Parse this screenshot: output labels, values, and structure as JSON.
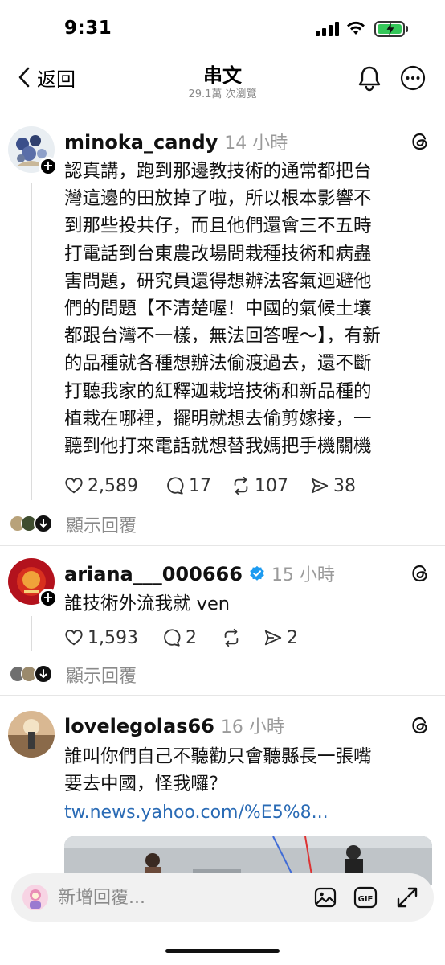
{
  "status": {
    "time": "9:31"
  },
  "header": {
    "back_label": "返回",
    "title": "串文",
    "subtitle": "29.1萬 次瀏覽"
  },
  "posts": [
    {
      "username": "minoka_candy",
      "time": "14 小時",
      "lines": [
        "認真講，跑到那邊教技術的通常都把台",
        "灣這邊的田放掉了啦，所以根本影響不",
        "到那些投共仔，而且他們還會三不五時",
        "打電話到台東農改場問栽種技術和病蟲",
        "害問題，研究員還得想辦法客氣迴避他",
        "們的問題【不清楚喔！中國的氣候土壤",
        "都跟台灣不一樣，無法回答喔～】，有新",
        "的品種就各種想辦法偷渡過去，還不斷",
        "打聽我家的紅釋迦栽培技術和新品種的",
        "植栽在哪裡，擺明就想去偷剪嫁接，一",
        "聽到他打來電話就想替我媽把手機關機"
      ],
      "likes": "2,589",
      "comments": "17",
      "reposts": "107",
      "shares": "38",
      "replies_label": "顯示回覆"
    },
    {
      "username": "ariana___000666",
      "time": "15 小時",
      "text": "誰技術外流我就 ven",
      "likes": "1,593",
      "comments": "2",
      "reposts": "",
      "shares": "2",
      "replies_label": "顯示回覆"
    },
    {
      "username": "lovelegolas66",
      "time": "16 小時",
      "lines": [
        "誰叫你們自己不聽勸只會聽縣長一張嘴",
        "要去中國，怪我囉？"
      ],
      "link": "tw.news.yahoo.com/%E5%8..."
    }
  ],
  "reply_bar": {
    "placeholder": "新增回覆..."
  },
  "icons": {
    "back": "chevron-left-icon",
    "bell": "bell-icon",
    "more": "more-icon",
    "threads": "threads-logo-icon",
    "like": "heart-icon",
    "comment": "comment-icon",
    "repost": "repost-icon",
    "share": "send-icon",
    "image": "image-icon",
    "gif": "gif-icon",
    "expand": "expand-icon"
  },
  "colors": {
    "link": "#2a6bb5",
    "verified": "#1d9bf0",
    "battery": "#34c759"
  }
}
